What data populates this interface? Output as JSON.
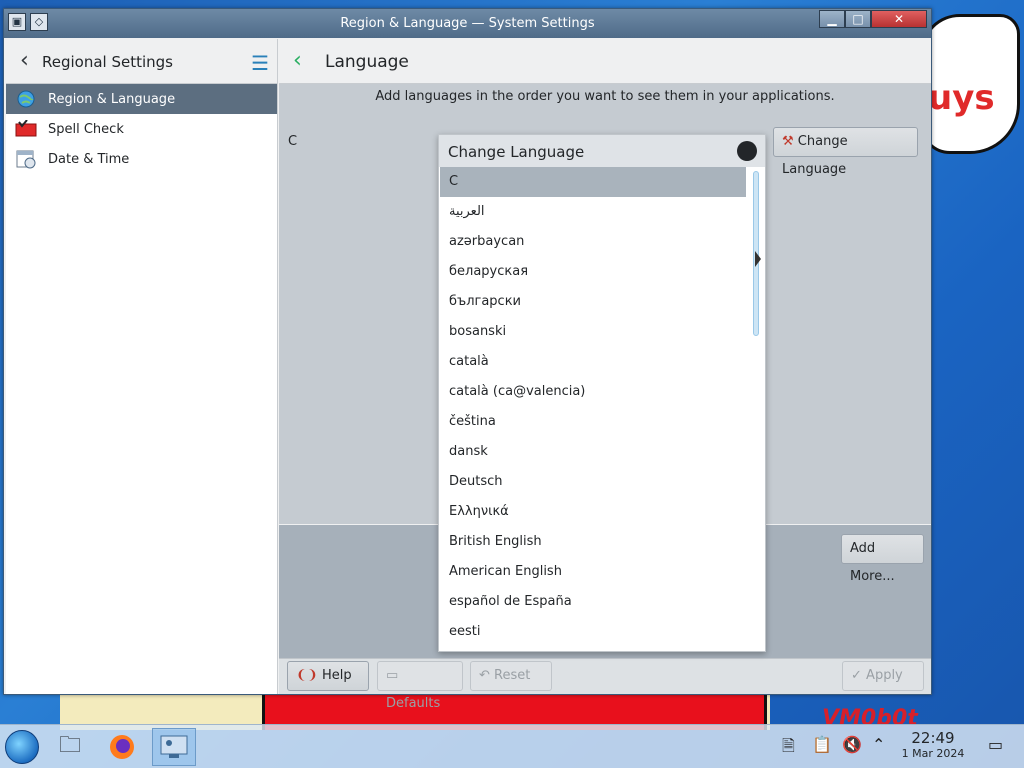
{
  "desktop": {
    "cloud_text": "uys",
    "signature_text": "VM0b0t"
  },
  "window": {
    "title": "Region & Language — System Settings",
    "minimize_icon": "minimize-icon",
    "maximize_icon": "maximize-icon",
    "close_label": "✕"
  },
  "sidebar": {
    "title": "Regional Settings",
    "items": [
      {
        "label": "Region & Language",
        "icon": "globe-icon"
      },
      {
        "label": "Spell Check",
        "icon": "spellcheck-icon"
      },
      {
        "label": "Date & Time",
        "icon": "calendar-icon"
      }
    ]
  },
  "main": {
    "title": "Language",
    "info": "Add languages in the order you want to see them in your applications.",
    "current_language": "C",
    "change_language_label": "Change Language",
    "add_more_label": "Add More..."
  },
  "footer": {
    "help_label": "Help",
    "defaults_label": "Defaults",
    "reset_label": "Reset",
    "apply_label": "Apply"
  },
  "dialog": {
    "title": "Change Language",
    "items": [
      "C",
      "العربية",
      "azərbaycan",
      "беларуская",
      "български",
      "bosanski",
      "català",
      "català (ca@valencia)",
      "čeština",
      "dansk",
      "Deutsch",
      "Ελληνικά",
      "British English",
      "American English",
      "español de España",
      "eesti"
    ],
    "selected_index": 0
  },
  "taskbar": {
    "time": "22:49",
    "date": "1 Mar 2024"
  },
  "colors": {
    "accent": "#2980b9",
    "selection": "#5c6e80",
    "back_arrow_green": "#27ae60"
  }
}
